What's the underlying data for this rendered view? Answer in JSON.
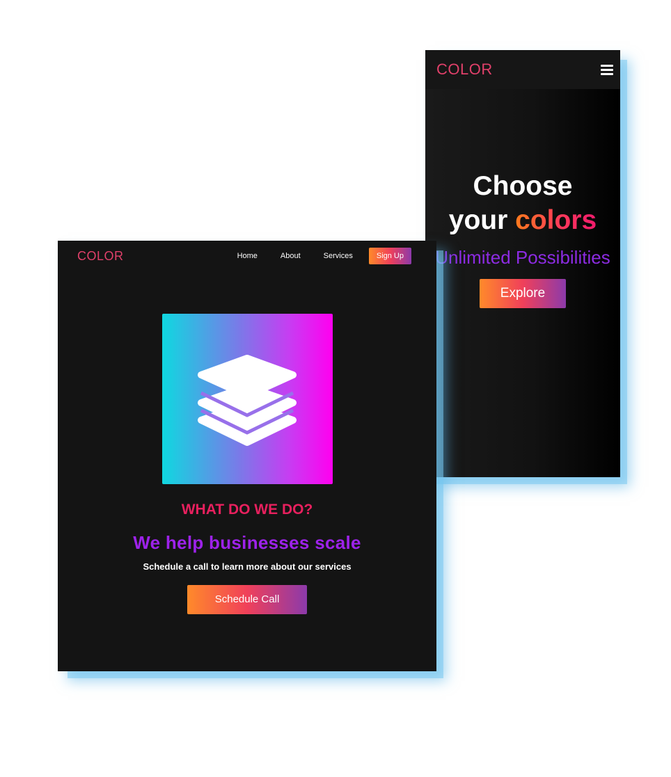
{
  "mobile": {
    "logo": "COLOR",
    "menu_icon": "hamburger-menu-icon",
    "hero": {
      "line1": "Choose",
      "line2_plain": "your ",
      "line2_accent": "colors",
      "subtitle": "Unlimited Possibilities",
      "button": "Explore"
    }
  },
  "desktop": {
    "logo": "COLOR",
    "nav": [
      {
        "label": "Home"
      },
      {
        "label": "About"
      },
      {
        "label": "Services"
      }
    ],
    "signup": "Sign Up",
    "graphic_icon": "layers-icon",
    "heading": "WHAT DO WE DO?",
    "title": "We help businesses scale",
    "description": "Schedule a call to learn more about our services",
    "button": "Schedule Call"
  },
  "colors": {
    "logo": "#e0406a",
    "heading": "#e8205e",
    "title": "#9d22ea",
    "subtitle": "#8c2be2",
    "button_gradient": [
      "#ff8a2a",
      "#f0405a",
      "#8c3aaa"
    ],
    "graphic_gradient": [
      "#0fd8e0",
      "#ff00f0"
    ],
    "background": "#141414"
  }
}
